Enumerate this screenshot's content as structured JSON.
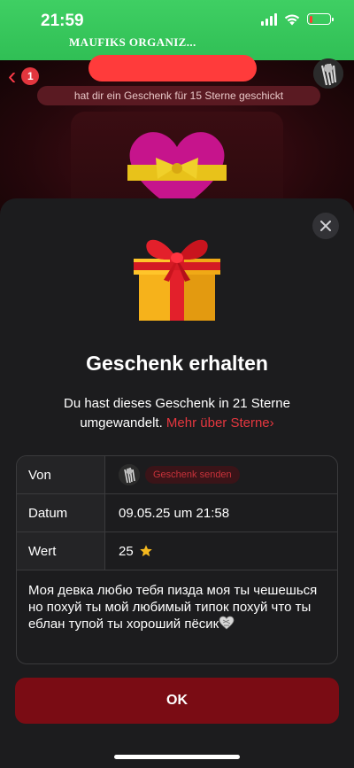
{
  "status_bar": {
    "time": "21:59",
    "banner": "MAUFIKS ORGANIZ...",
    "battery_level": 0.15,
    "signal_bars": 4
  },
  "chat": {
    "unread_count": "1",
    "subtitle": "hat dir ein Geschenk für 15 Sterne geschickt"
  },
  "sheet": {
    "title": "Geschenk erhalten",
    "description_text": "Du hast dieses Geschenk in 21 Sterne umgewandelt.",
    "description_link": "Mehr über Sterne",
    "rows": {
      "from": {
        "label": "Von",
        "action": "Geschenk senden"
      },
      "date": {
        "label": "Datum",
        "value": "09.05.25 um 21:58"
      },
      "value": {
        "label": "Wert",
        "value": "25"
      }
    },
    "message": "Моя девка любю тебя пизда моя ты чешешься но похуй ты мой любимый типок похуй что ты еблан тупой ты хороший пёсик",
    "ok_label": "OK"
  },
  "colors": {
    "accent": "#e5373f",
    "button": "#7a0c14",
    "sheet_bg": "#1c1c1e",
    "banner": "#3fcf63"
  }
}
